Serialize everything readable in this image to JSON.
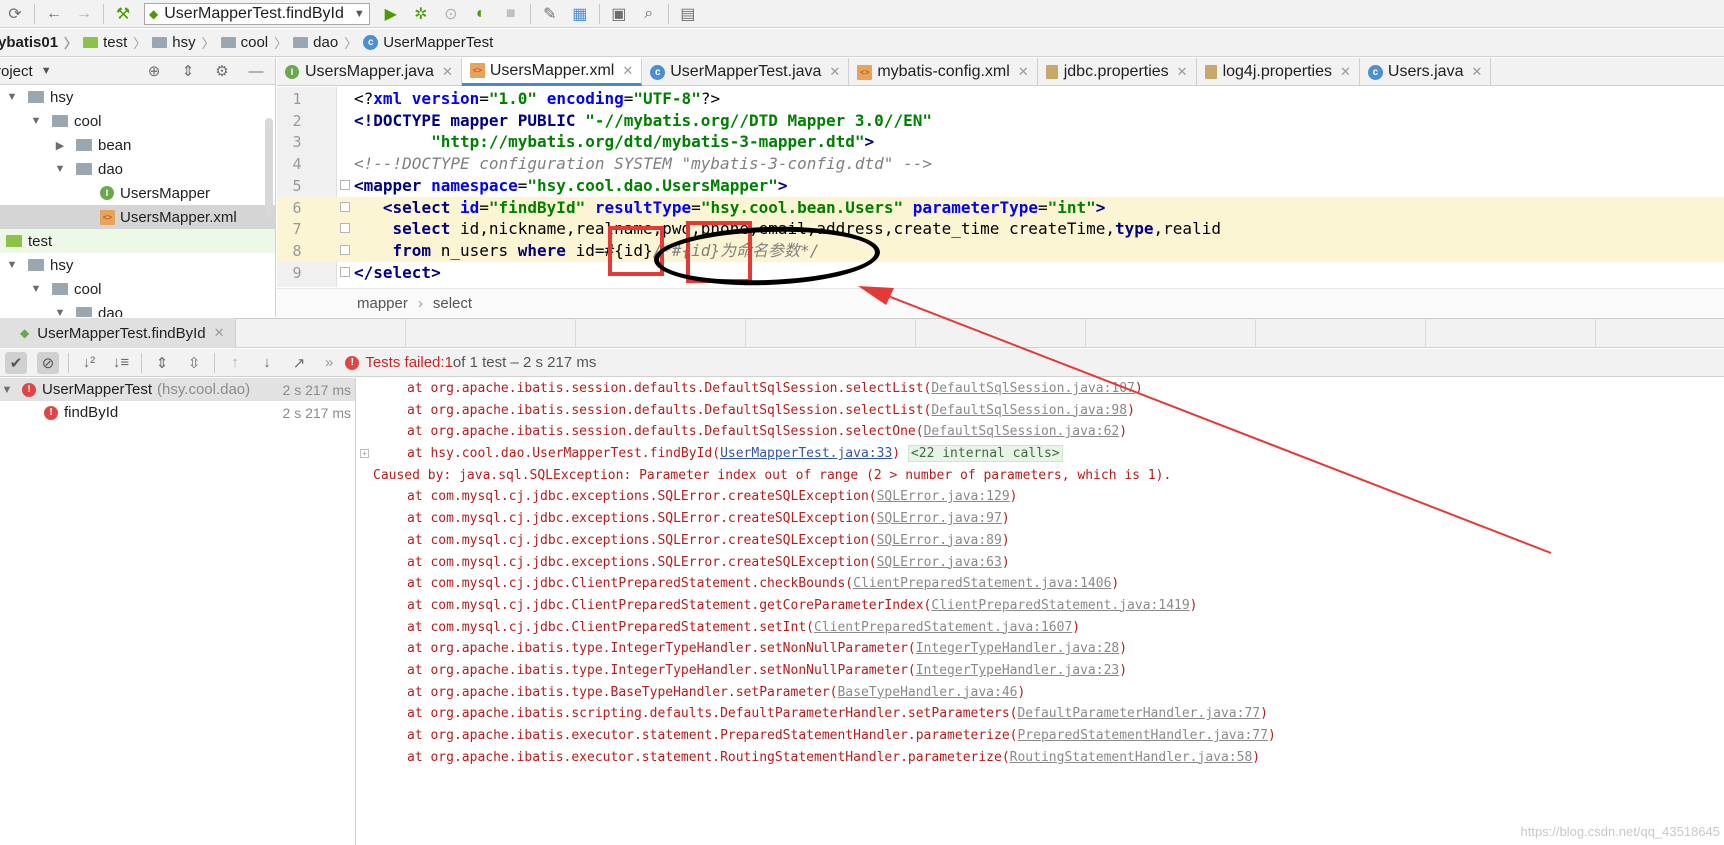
{
  "toolbar": {
    "run_config": "UserMapperTest.findById",
    "icons": [
      "sync-icon",
      "back-icon",
      "forward-icon",
      "build-icon",
      "run-icon",
      "debug-icon",
      "coverage-icon",
      "profile-icon",
      "stop-icon",
      "settings-icon",
      "structure-icon",
      "terminal-icon",
      "search-icon",
      "sdk-icon"
    ]
  },
  "breadcrumb": [
    "ybatis01",
    "test",
    "hsy",
    "cool",
    "dao",
    "UserMapperTest"
  ],
  "project": {
    "title": "roject",
    "tree": [
      {
        "label": "hsy",
        "kind": "folder",
        "depth": 0,
        "expanded": true
      },
      {
        "label": "cool",
        "kind": "folder",
        "depth": 1,
        "expanded": true
      },
      {
        "label": "bean",
        "kind": "folder",
        "depth": 2,
        "expanded": false
      },
      {
        "label": "dao",
        "kind": "folder",
        "depth": 2,
        "expanded": true
      },
      {
        "label": "UsersMapper",
        "kind": "interface",
        "depth": 3
      },
      {
        "label": "UsersMapper.xml",
        "kind": "xml",
        "depth": 3,
        "selected": true
      },
      {
        "label": "test",
        "kind": "test-folder",
        "depth": -1
      },
      {
        "label": "hsy",
        "kind": "folder",
        "depth": 0,
        "expanded": true
      },
      {
        "label": "cool",
        "kind": "folder",
        "depth": 1,
        "expanded": true
      },
      {
        "label": "dao",
        "kind": "folder",
        "depth": 2,
        "expanded": true
      }
    ]
  },
  "editor_tabs": [
    {
      "label": "UsersMapper.java",
      "icon": "interface"
    },
    {
      "label": "UsersMapper.xml",
      "icon": "xml",
      "active": true
    },
    {
      "label": "UserMapperTest.java",
      "icon": "class"
    },
    {
      "label": "mybatis-config.xml",
      "icon": "xml"
    },
    {
      "label": "jdbc.properties",
      "icon": "props"
    },
    {
      "label": "log4j.properties",
      "icon": "props"
    },
    {
      "label": "Users.java",
      "icon": "class"
    }
  ],
  "editor": {
    "lines": [
      {
        "n": "1",
        "parts": [
          [
            "t-plain",
            "<?"
          ],
          [
            "t-attr",
            "xml version"
          ],
          [
            "t-plain",
            "="
          ],
          [
            "t-val",
            "\"1.0\""
          ],
          [
            "t-plain",
            " "
          ],
          [
            "t-attr",
            "encoding"
          ],
          [
            "t-plain",
            "="
          ],
          [
            "t-val",
            "\"UTF-8\""
          ],
          [
            "t-plain",
            "?>"
          ]
        ]
      },
      {
        "n": "2",
        "parts": [
          [
            "t-tag",
            "<!DOCTYPE mapper PUBLIC "
          ],
          [
            "t-val",
            "\"-//mybatis.org//DTD Mapper 3.0//EN\""
          ]
        ]
      },
      {
        "n": "3",
        "parts": [
          [
            "t-plain",
            "        "
          ],
          [
            "t-val",
            "\"http://mybatis.org/dtd/mybatis-3-mapper.dtd\""
          ],
          [
            "t-tag",
            ">"
          ]
        ]
      },
      {
        "n": "4",
        "parts": [
          [
            "t-com",
            "<!--!DOCTYPE configuration SYSTEM \"mybatis-3-config.dtd\" -->"
          ]
        ]
      },
      {
        "n": "5",
        "parts": [
          [
            "t-tag",
            "<mapper "
          ],
          [
            "t-attr",
            "namespace"
          ],
          [
            "t-plain",
            "="
          ],
          [
            "t-val",
            "\"hsy.cool.dao.UsersMapper\""
          ],
          [
            "t-tag",
            ">"
          ]
        ]
      },
      {
        "n": "6",
        "hl": true,
        "parts": [
          [
            "t-plain",
            "   "
          ],
          [
            "t-tag",
            "<select "
          ],
          [
            "t-attr",
            "id"
          ],
          [
            "t-plain",
            "="
          ],
          [
            "t-val",
            "\"findById\""
          ],
          [
            "t-plain",
            " "
          ],
          [
            "t-attr",
            "resultType"
          ],
          [
            "t-plain",
            "="
          ],
          [
            "t-val",
            "\"hsy.cool.bean.Users\""
          ],
          [
            "t-plain",
            " "
          ],
          [
            "t-attr",
            "parameterType"
          ],
          [
            "t-plain",
            "="
          ],
          [
            "t-val",
            "\"int\""
          ],
          [
            "t-tag",
            ">"
          ]
        ]
      },
      {
        "n": "7",
        "hl": true,
        "parts": [
          [
            "t-plain",
            "    "
          ],
          [
            "t-kw",
            "select "
          ],
          [
            "t-plain",
            "id,nickname,realname,pwd,phone,email,address,create_time createTime,"
          ],
          [
            "t-kw",
            "type"
          ],
          [
            "t-plain",
            ",realid"
          ]
        ]
      },
      {
        "n": "8",
        "hl": true,
        "parts": [
          [
            "t-plain",
            "    "
          ],
          [
            "t-kw",
            "from "
          ],
          [
            "t-plain",
            "n_users "
          ],
          [
            "t-kw",
            "where "
          ],
          [
            "t-plain",
            "id=#{id}"
          ],
          [
            "t-com",
            "/*#{id}为命名参数*/"
          ]
        ]
      },
      {
        "n": "9",
        "parts": [
          [
            "t-tag",
            "</select>"
          ]
        ]
      }
    ],
    "crumbs": [
      "mapper",
      "select"
    ]
  },
  "run": {
    "tab_label": "UserMapperTest.findById",
    "status_prefix": "Tests failed: ",
    "status_count": "1",
    "status_suffix": " of 1 test – 2 s 217 ms",
    "tree": [
      {
        "label": "UserMapperTest",
        "pkg": "(hsy.cool.dao)",
        "time": "2 s 217 ms",
        "depth": 0
      },
      {
        "label": "findById",
        "pkg": "",
        "time": "2 s 217 ms",
        "depth": 1
      }
    ]
  },
  "console": [
    {
      "kind": "at",
      "text": "at org.apache.ibatis.session.defaults.DefaultSqlSession.selectList(",
      "link": "DefaultSqlSession.java:107"
    },
    {
      "kind": "at",
      "text": "at org.apache.ibatis.session.defaults.DefaultSqlSession.selectList(",
      "link": "DefaultSqlSession.java:98"
    },
    {
      "kind": "at",
      "text": "at org.apache.ibatis.session.defaults.DefaultSqlSession.selectOne(",
      "link": "DefaultSqlSession.java:62"
    },
    {
      "kind": "at-internal",
      "text": "at hsy.cool.dao.UserMapperTest.findById(",
      "link": "UserMapperTest.java:33",
      "internal": "<22 internal calls>"
    },
    {
      "kind": "cause",
      "text": "Caused by: java.sql.SQLException: Parameter index out of range (2 > number of parameters, which is 1)."
    },
    {
      "kind": "at",
      "text": "at com.mysql.cj.jdbc.exceptions.SQLError.createSQLException(",
      "link": "SQLError.java:129"
    },
    {
      "kind": "at",
      "text": "at com.mysql.cj.jdbc.exceptions.SQLError.createSQLException(",
      "link": "SQLError.java:97"
    },
    {
      "kind": "at",
      "text": "at com.mysql.cj.jdbc.exceptions.SQLError.createSQLException(",
      "link": "SQLError.java:89"
    },
    {
      "kind": "at",
      "text": "at com.mysql.cj.jdbc.exceptions.SQLError.createSQLException(",
      "link": "SQLError.java:63"
    },
    {
      "kind": "at",
      "text": "at com.mysql.cj.jdbc.ClientPreparedStatement.checkBounds(",
      "link": "ClientPreparedStatement.java:1406"
    },
    {
      "kind": "at",
      "text": "at com.mysql.cj.jdbc.ClientPreparedStatement.getCoreParameterIndex(",
      "link": "ClientPreparedStatement.java:1419"
    },
    {
      "kind": "at",
      "text": "at com.mysql.cj.jdbc.ClientPreparedStatement.setInt(",
      "link": "ClientPreparedStatement.java:1607"
    },
    {
      "kind": "at",
      "text": "at org.apache.ibatis.type.IntegerTypeHandler.setNonNullParameter(",
      "link": "IntegerTypeHandler.java:28"
    },
    {
      "kind": "at",
      "text": "at org.apache.ibatis.type.IntegerTypeHandler.setNonNullParameter(",
      "link": "IntegerTypeHandler.java:23"
    },
    {
      "kind": "at",
      "text": "at org.apache.ibatis.type.BaseTypeHandler.setParameter(",
      "link": "BaseTypeHandler.java:46"
    },
    {
      "kind": "at",
      "text": "at org.apache.ibatis.scripting.defaults.DefaultParameterHandler.setParameters(",
      "link": "DefaultParameterHandler.java:77"
    },
    {
      "kind": "at",
      "text": "at org.apache.ibatis.executor.statement.PreparedStatementHandler.parameterize(",
      "link": "PreparedStatementHandler.java:77"
    },
    {
      "kind": "at",
      "text": "at org.apache.ibatis.executor.statement.RoutingStatementHandler.parameterize(",
      "link": "RoutingStatementHandler.java:58"
    }
  ],
  "watermark": "https://blog.csdn.net/qq_43518645",
  "colors": {
    "annotation_box": "#e53935",
    "annotation_ellipse": "#000000",
    "error_text": "#b71c1c",
    "selection": "#d5d5d5"
  }
}
